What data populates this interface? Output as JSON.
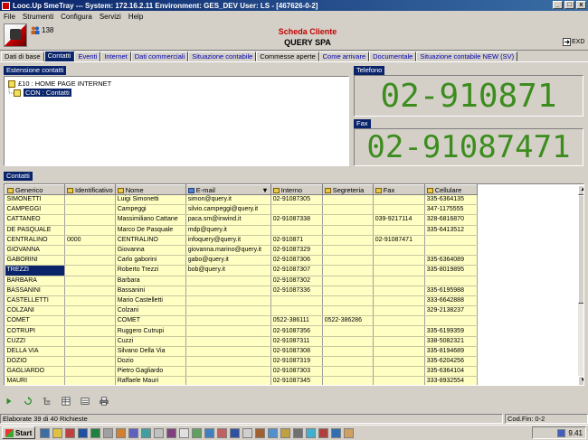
{
  "window": {
    "title": "Looc.Up SmeTray --- System: 172.16.2.11 Environment: GES_DEV User: LS - [467626-0-2]",
    "min_glyph": "_",
    "max_glyph": "□",
    "close_glyph": "x"
  },
  "menu": [
    "File",
    "Strumenti",
    "Configura",
    "Servizi",
    "Help"
  ],
  "header": {
    "users_count": "138",
    "scheda_label": "Scheda Cliente",
    "company": "QUERY SPA",
    "exd_label": "EXD"
  },
  "tabs": [
    "Dati di base",
    "Contatti",
    "Eventi",
    "Internet",
    "Dati commerciali",
    "Situazione contabile",
    "Commesse aperte",
    "Come arrivare",
    "Documentale",
    "Situazione contabile NEW (SV)"
  ],
  "active_tab_index": 1,
  "estensione": {
    "label": "Estensione contatti",
    "items": [
      {
        "text": "£10 : HOME PAGE INTERNET",
        "selected": false
      },
      {
        "text": "CON : Contatti",
        "selected": true
      }
    ]
  },
  "telefono": {
    "label": "Telefono",
    "value": "02-910871"
  },
  "fax": {
    "label": "Fax",
    "value": "02-91087471"
  },
  "contatti": {
    "label": "Contatti",
    "columns": [
      "Generico",
      "Identificativo",
      "Nome",
      "E-mail",
      "Interno",
      "Segreteria",
      "Fax",
      "Cellulare"
    ],
    "rows": [
      [
        "SIMONETTI",
        "",
        "Luigi Simonetti",
        "simon@query.it",
        "02-91087305",
        "",
        "",
        "335-6364135"
      ],
      [
        "CAMPEGGI",
        "",
        "Campeggi",
        "silvio.campeggi@query.it",
        "",
        "",
        "",
        "347-1175555"
      ],
      [
        "CATTANEO",
        "",
        "Massimiliano Cattane",
        "paca.sm@inwind.it",
        "02-91087338",
        "",
        "039-9217114",
        "328-6816870"
      ],
      [
        "DE PASQUALE",
        "",
        "Marco De Pasquale",
        "mdp@query.it",
        "",
        "",
        "",
        "335-6413512"
      ],
      [
        "CENTRALINO",
        "0000",
        "CENTRALINO",
        "infoquery@query.it",
        "02-910871",
        "",
        "02-91087471",
        ""
      ],
      [
        "GIOVANNA",
        "",
        "Giovanna",
        "giovanna.marino@query.it",
        "02-91087329",
        "",
        "",
        ""
      ],
      [
        "GABORINI",
        "",
        "Carlo gaborini",
        "gabo@query.it",
        "02-91087306",
        "",
        "",
        "335-6364089"
      ],
      [
        "TREZZI",
        "",
        "Roberto Trezzi",
        "bob@query.it",
        "02-91087307",
        "",
        "",
        "335-8019895"
      ],
      [
        "BARBARA",
        "",
        "Barbara",
        "",
        "02-91087302",
        "",
        "",
        ""
      ],
      [
        "BASSANINI",
        "",
        "Bassanini",
        "",
        "02-91087336",
        "",
        "",
        "335-6195988"
      ],
      [
        "CASTELLETTI",
        "",
        "Mario Castelletti",
        "",
        "",
        "",
        "",
        "333-6642888"
      ],
      [
        "COLZANI",
        "",
        "Colzani",
        "",
        "",
        "",
        "",
        "329-2138237"
      ],
      [
        "COMET",
        "",
        "COMET",
        "",
        "0522-386111",
        "0522-386286",
        "",
        ""
      ],
      [
        "COTRUPI",
        "",
        "Ruggero Cutrupi",
        "",
        "02-91087356",
        "",
        "",
        "335-6199359"
      ],
      [
        "CUZZI",
        "",
        "Cuzzi",
        "",
        "02-91087311",
        "",
        "",
        "338-5082321"
      ],
      [
        "DELLA VIA",
        "",
        "Silvano Della Via",
        "",
        "02-91087308",
        "",
        "",
        "335-8194689"
      ],
      [
        "DOZIO",
        "",
        "Dozio",
        "",
        "02-91087319",
        "",
        "",
        "335-6204256"
      ],
      [
        "GAGLIARDO",
        "",
        "Pietro Gagliardo",
        "",
        "02-91087303",
        "",
        "",
        "335-6364104"
      ],
      [
        "MAURI",
        "",
        "Raffaele Mauri",
        "",
        "02-91087345",
        "",
        "",
        "333-8932554"
      ]
    ],
    "selected_row": 7
  },
  "status": {
    "left": "Elaborate 39 di 40 Richieste",
    "right": "Cod.Fin: 0-2"
  },
  "taskbar": {
    "start_label": "Start",
    "clock": "9.41"
  },
  "colors": {
    "titlebar": "#0a246a",
    "accent_red": "#c00000",
    "big_number_green": "#3c8c1e",
    "grid_cell_yellow": "#ffffc4"
  }
}
